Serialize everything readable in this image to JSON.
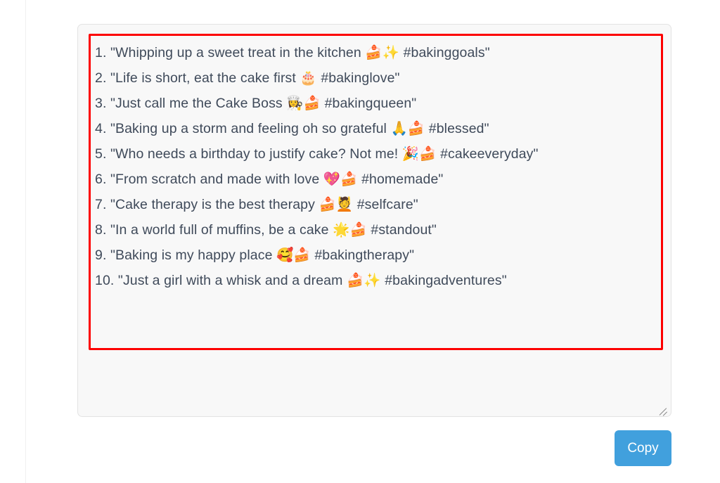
{
  "page": {
    "background_color": "#ffffff",
    "divider_color": "#f0f0f0"
  },
  "output_panel": {
    "name": "generated-captions-textarea",
    "background_color": "#f8f8f8",
    "border_color": "#e3e3e3",
    "highlight_border_color": "#fd0000",
    "resize_handle": "resize-grip-icon",
    "lines": [
      "1. \"Whipping up a sweet treat in the kitchen 🍰✨ #bakinggoals\"",
      "2. \"Life is short, eat the cake first 🎂 #bakinglove\"",
      "3. \"Just call me the Cake Boss 👩‍🍳🍰 #bakingqueen\"",
      "4. \"Baking up a storm and feeling oh so grateful 🙏🍰 #blessed\"",
      "5. \"Who needs a birthday to justify cake? Not me! 🎉🍰 #cakeeveryday\"",
      "6. \"From scratch and made with love 💖🍰 #homemade\"",
      "7. \"Cake therapy is the best therapy 🍰💆 #selfcare\"",
      "8. \"In a world full of muffins, be a cake 🌟🍰 #standout\"",
      "9. \"Baking is my happy place 🥰🍰 #bakingtherapy\"",
      "10. \"Just a girl with a whisk and a dream 🍰✨ #bakingadventures\""
    ]
  },
  "actions": {
    "copy_label": "Copy",
    "copy_button_color": "#41a0dd",
    "copy_button_text_color": "#ffffff"
  }
}
